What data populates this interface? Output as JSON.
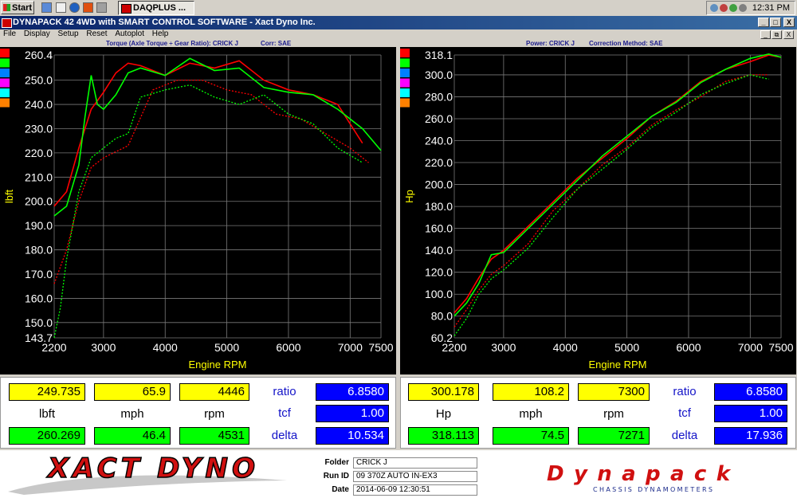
{
  "taskbar": {
    "start_label": "Start",
    "task_label": "DAQPLUS ...",
    "clock": "12:31 PM"
  },
  "window": {
    "title": "DYNAPACK 42 4WD with SMART CONTROL SOFTWARE - Xact Dyno Inc.",
    "minimize": "_",
    "maximize": "□",
    "close": "X"
  },
  "menu": [
    "File",
    "Display",
    "Setup",
    "Reset",
    "Autoplot",
    "Help"
  ],
  "mdi_buttons": [
    "_",
    "⧉",
    "X"
  ],
  "left_panel": {
    "header_left": "Torque (Axle Torque ÷ Gear Ratio): CRICK J",
    "header_right": "Corr: SAE",
    "readout_top": [
      "249.735",
      "65.9",
      "4446"
    ],
    "readout_units": [
      "lbft",
      "mph",
      "rpm"
    ],
    "readout_bottom": [
      "260.269",
      "46.4",
      "4531"
    ],
    "right_labels": [
      "ratio",
      "tcf",
      "delta"
    ],
    "right_values": [
      "6.8580",
      "1.00",
      "10.534"
    ]
  },
  "right_panel": {
    "header_left": "Power: CRICK J",
    "header_right": "Correction Method: SAE",
    "readout_top": [
      "300.178",
      "108.2",
      "7300"
    ],
    "readout_units": [
      "Hp",
      "mph",
      "rpm"
    ],
    "readout_bottom": [
      "318.113",
      "74.5",
      "7271"
    ],
    "right_labels": [
      "ratio",
      "tcf",
      "delta"
    ],
    "right_values": [
      "6.8580",
      "1.00",
      "17.936"
    ]
  },
  "footer": {
    "folder_label": "Folder",
    "folder_value": "CRICK J",
    "runid_label": "Run ID",
    "runid_value": "09 370Z AUTO IN-EX3",
    "date_label": "Date",
    "date_value": "2014-06-09 12:30:51",
    "logo_left": "XACT DYNO",
    "logo_right": "Dynapack",
    "logo_right_sub": "CHASSIS DYNAMOMETERS"
  },
  "legend_colors": [
    "#ff0000",
    "#00ff00",
    "#0080ff",
    "#ff00ff",
    "#00ffff",
    "#ff8000"
  ],
  "chart_data": [
    {
      "type": "line",
      "xlabel": "Engine RPM",
      "ylabel": "lbft",
      "xlim": [
        2200,
        7500
      ],
      "ylim": [
        143.7,
        260.4
      ],
      "xticks": [
        "2200",
        "3000",
        "4000",
        "5000",
        "6000",
        "7000",
        "7500"
      ],
      "yticks": [
        "260.4",
        "250.0",
        "240.0",
        "230.0",
        "220.0",
        "210.0",
        "200.0",
        "190.0",
        "180.0",
        "170.0",
        "160.0",
        "150.0",
        "143.7"
      ],
      "grid": true,
      "series": [
        {
          "color": "#ff0000",
          "style": "solid",
          "x": [
            2200,
            2400,
            2600,
            2800,
            3000,
            3200,
            3400,
            3600,
            4000,
            4400,
            4800,
            5200,
            5600,
            6000,
            6400,
            6800,
            7200
          ],
          "y": [
            198,
            204,
            222,
            238,
            245,
            253,
            257,
            256,
            252,
            257,
            255,
            258,
            250,
            246,
            244,
            240,
            224
          ]
        },
        {
          "color": "#00ff00",
          "style": "solid",
          "x": [
            2200,
            2400,
            2600,
            2700,
            2800,
            2900,
            3000,
            3200,
            3400,
            3600,
            4000,
            4400,
            4800,
            5200,
            5600,
            6000,
            6400,
            6800,
            7200,
            7500
          ],
          "y": [
            194,
            198,
            215,
            235,
            252,
            240,
            238,
            244,
            253,
            255,
            252,
            259,
            254,
            255,
            247,
            245,
            244,
            238,
            230,
            221
          ]
        },
        {
          "color": "#ff0000",
          "style": "dotted",
          "x": [
            2200,
            2400,
            2600,
            2800,
            3000,
            3400,
            3800,
            4200,
            4600,
            5000,
            5400,
            5800,
            6200,
            6600,
            7000,
            7300
          ],
          "y": [
            166,
            180,
            200,
            214,
            218,
            223,
            246,
            250,
            250,
            246,
            244,
            236,
            234,
            228,
            222,
            216
          ]
        },
        {
          "color": "#00ff00",
          "style": "dotted",
          "x": [
            2200,
            2300,
            2400,
            2600,
            2800,
            3000,
            3200,
            3400,
            3600,
            4000,
            4400,
            4800,
            5200,
            5600,
            6000,
            6400,
            6800,
            7200
          ],
          "y": [
            143.7,
            156,
            176,
            204,
            218,
            222,
            226,
            228,
            243,
            246,
            248,
            243,
            240,
            244,
            236,
            232,
            222,
            216
          ]
        }
      ]
    },
    {
      "type": "line",
      "xlabel": "Engine RPM",
      "ylabel": "Hp",
      "xlim": [
        2200,
        7500
      ],
      "ylim": [
        60.2,
        318.1
      ],
      "xticks": [
        "2200",
        "3000",
        "4000",
        "5000",
        "6000",
        "7000",
        "7500"
      ],
      "yticks": [
        "318.1",
        "300.0",
        "280.0",
        "260.0",
        "240.0",
        "220.0",
        "200.0",
        "180.0",
        "160.0",
        "140.0",
        "120.0",
        "100.0",
        "80.0",
        "60.2"
      ],
      "grid": true,
      "series": [
        {
          "color": "#ff0000",
          "style": "solid",
          "x": [
            2200,
            2400,
            2600,
            2800,
            3000,
            3400,
            3800,
            4200,
            4600,
            5000,
            5400,
            5800,
            6200,
            6600,
            7000,
            7300,
            7500
          ],
          "y": [
            83,
            96,
            115,
            132,
            140,
            162,
            184,
            206,
            224,
            242,
            262,
            276,
            294,
            305,
            312,
            318,
            316
          ]
        },
        {
          "color": "#00ff00",
          "style": "solid",
          "x": [
            2200,
            2400,
            2600,
            2800,
            3000,
            3400,
            3800,
            4200,
            4600,
            5000,
            5400,
            5800,
            6200,
            6600,
            7000,
            7300,
            7500
          ],
          "y": [
            80,
            92,
            110,
            136,
            138,
            160,
            182,
            204,
            226,
            244,
            262,
            275,
            293,
            305,
            315,
            319,
            316
          ]
        },
        {
          "color": "#ff0000",
          "style": "dotted",
          "x": [
            2200,
            2400,
            2600,
            2800,
            3000,
            3400,
            3800,
            4200,
            4600,
            5000,
            5400,
            5800,
            6200,
            6600,
            7000,
            7300
          ],
          "y": [
            70,
            86,
            104,
            118,
            126,
            146,
            176,
            196,
            218,
            234,
            254,
            268,
            280,
            294,
            300,
            300
          ]
        },
        {
          "color": "#00ff00",
          "style": "dotted",
          "x": [
            2200,
            2400,
            2600,
            2800,
            3000,
            3400,
            3800,
            4200,
            4600,
            5000,
            5400,
            5800,
            6200,
            6600,
            7000,
            7300
          ],
          "y": [
            62,
            78,
            100,
            114,
            122,
            142,
            170,
            196,
            214,
            232,
            252,
            266,
            282,
            292,
            300,
            296
          ]
        }
      ]
    }
  ]
}
